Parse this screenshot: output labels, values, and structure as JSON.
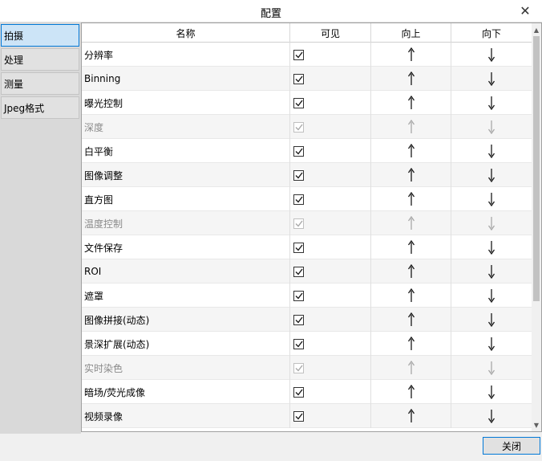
{
  "window": {
    "title": "配置",
    "close_glyph": "✕"
  },
  "sidebar": {
    "items": [
      {
        "label": "拍摄",
        "active": true
      },
      {
        "label": "处理",
        "active": false
      },
      {
        "label": "测量",
        "active": false
      },
      {
        "label": "Jpeg格式",
        "active": false
      }
    ]
  },
  "table": {
    "columns": [
      "名称",
      "可见",
      "向上",
      "向下"
    ],
    "rows": [
      {
        "name": "分辨率",
        "visible": true,
        "enabled": true
      },
      {
        "name": "Binning",
        "visible": true,
        "enabled": true
      },
      {
        "name": "曝光控制",
        "visible": true,
        "enabled": true
      },
      {
        "name": "深度",
        "visible": true,
        "enabled": false
      },
      {
        "name": "白平衡",
        "visible": true,
        "enabled": true
      },
      {
        "name": "图像调整",
        "visible": true,
        "enabled": true
      },
      {
        "name": "直方图",
        "visible": true,
        "enabled": true
      },
      {
        "name": "温度控制",
        "visible": true,
        "enabled": false
      },
      {
        "name": "文件保存",
        "visible": true,
        "enabled": true
      },
      {
        "name": "ROI",
        "visible": true,
        "enabled": true
      },
      {
        "name": "遮罩",
        "visible": true,
        "enabled": true
      },
      {
        "name": "图像拼接(动态)",
        "visible": true,
        "enabled": true
      },
      {
        "name": "景深扩展(动态)",
        "visible": true,
        "enabled": true
      },
      {
        "name": "实时染色",
        "visible": true,
        "enabled": false
      },
      {
        "name": "暗场/荧光成像",
        "visible": true,
        "enabled": true
      },
      {
        "name": "视频录像",
        "visible": true,
        "enabled": true
      }
    ]
  },
  "icons": {
    "up": "arrow-up-icon",
    "down": "arrow-down-icon",
    "check": "checkmark-icon"
  },
  "footer": {
    "close_label": "关闭"
  },
  "colors": {
    "accent": "#0078d7",
    "active_tab_bg": "#cce4f7",
    "disabled_text": "#8a8a8a"
  }
}
